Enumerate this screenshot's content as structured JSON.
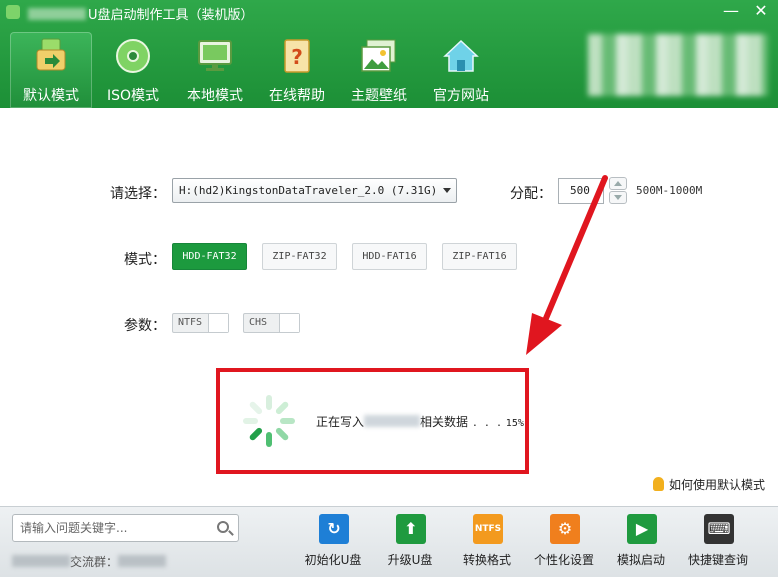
{
  "window": {
    "title": "U盘启动制作工具（装机版）",
    "minimize_glyph": "—",
    "close_glyph": "✕"
  },
  "nav": [
    {
      "label": "默认模式",
      "icon": "usb-drive-icon",
      "active": true
    },
    {
      "label": "ISO模式",
      "icon": "disc-icon",
      "active": false
    },
    {
      "label": "本地模式",
      "icon": "monitor-icon",
      "active": false
    },
    {
      "label": "在线帮助",
      "icon": "help-document-icon",
      "active": false
    },
    {
      "label": "主题壁纸",
      "icon": "wallpaper-icon",
      "active": false
    },
    {
      "label": "官方网站",
      "icon": "home-icon",
      "active": false
    }
  ],
  "main": {
    "select_label": "请选择：",
    "device_value": "H:(hd2)KingstonDataTraveler_2.0 (7.31G)",
    "alloc_label": "分配：",
    "alloc_value": "500",
    "alloc_range": "500M-1000M",
    "mode_label": "模式：",
    "modes": [
      {
        "label": "HDD-FAT32",
        "active": true
      },
      {
        "label": "ZIP-FAT32",
        "active": false
      },
      {
        "label": "HDD-FAT16",
        "active": false
      },
      {
        "label": "ZIP-FAT16",
        "active": false
      }
    ],
    "param_label": "参数：",
    "params": [
      {
        "label": "NTFS",
        "enabled": false
      },
      {
        "label": "CHS",
        "enabled": false
      }
    ],
    "progress": {
      "text_before": "正在写入",
      "text_after": "相关数据",
      "dots": ". . .",
      "percent_text": "15%",
      "percent": 15
    },
    "help_link": "如何使用默认模式"
  },
  "footer": {
    "search_placeholder": "请输入问题关键字...",
    "qq_text": "交流群：",
    "tools": [
      {
        "label": "初始化U盘",
        "icon": "refresh-icon",
        "color": "#1e7fd6",
        "glyph": "↻"
      },
      {
        "label": "升级U盘",
        "icon": "upgrade-arrow-icon",
        "color": "#1f9a3f",
        "glyph": "⬆"
      },
      {
        "label": "转换格式",
        "icon": "ntfs-icon",
        "color": "#f39a1e",
        "glyph": "NTFS"
      },
      {
        "label": "个性化设置",
        "icon": "gear-icon",
        "color": "#f07f1d",
        "glyph": "⚙"
      },
      {
        "label": "模拟启动",
        "icon": "simulate-boot-icon",
        "color": "#1f9a3f",
        "glyph": "▶"
      },
      {
        "label": "快捷键查询",
        "icon": "keyboard-icon",
        "color": "#333333",
        "glyph": "⌨"
      }
    ]
  },
  "colors": {
    "header_green": "#1c8f36",
    "active_mode": "#1c9a3e",
    "highlight_red": "#e0161f"
  }
}
